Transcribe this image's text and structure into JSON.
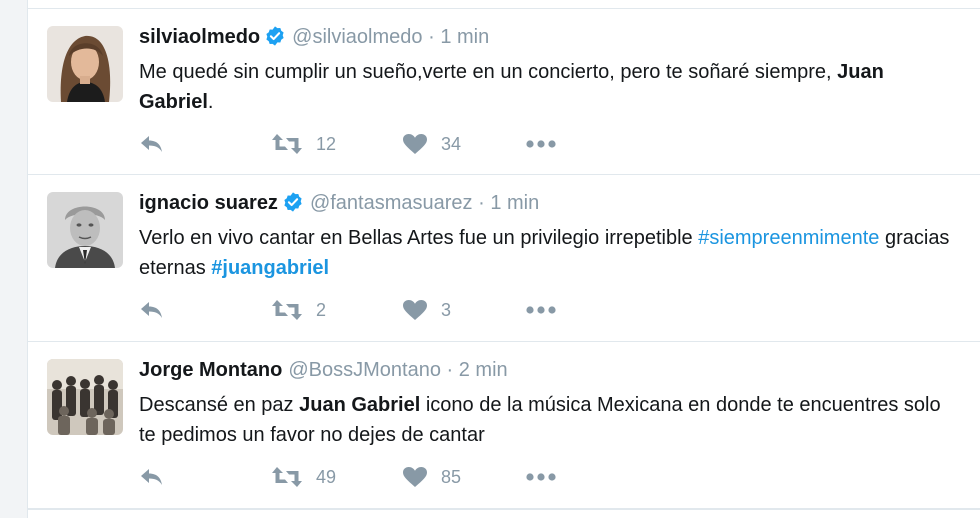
{
  "colors": {
    "background": "#f2f4f6",
    "card": "#ffffff",
    "text": "#14171a",
    "muted": "#8899a6",
    "link": "#1b95e0",
    "verified": "#1da1f2",
    "divider": "#e1e8ed"
  },
  "tweets": [
    {
      "name": "silviaolmedo",
      "verified": true,
      "handle": "@silviaolmedo",
      "separator": "·",
      "time": "1 min",
      "text": [
        {
          "t": "Me quedé sin cumplir un sueño,verte en un concierto, pero te soñaré siempre, "
        },
        {
          "t": "Juan Gabriel",
          "bold": true
        },
        {
          "t": "."
        }
      ],
      "replies": "",
      "retweets": "12",
      "likes": "34",
      "avatar": "portrait-woman"
    },
    {
      "name": "ignacio suarez",
      "verified": true,
      "handle": "@fantasmasuarez",
      "separator": "·",
      "time": "1 min",
      "text": [
        {
          "t": "Verlo en vivo cantar en Bellas Artes fue un privilegio irrepetible "
        },
        {
          "t": "#siempreenmimente",
          "hashtag": true
        },
        {
          "t": " gracias eternas "
        },
        {
          "t": "#juangabriel",
          "hashtag": true,
          "bold": true
        }
      ],
      "replies": "",
      "retweets": "2",
      "likes": "3",
      "avatar": "portrait-man-bw"
    },
    {
      "name": "Jorge Montano",
      "verified": false,
      "handle": "@BossJMontano",
      "separator": "·",
      "time": "2 min",
      "text": [
        {
          "t": "Descansé en paz "
        },
        {
          "t": "Juan Gabriel",
          "bold": true
        },
        {
          "t": " icono de la música Mexicana en donde te encuentres solo te pedimos un favor no dejes de cantar"
        }
      ],
      "replies": "",
      "retweets": "49",
      "likes": "85",
      "avatar": "group-photo"
    }
  ],
  "icons": {
    "reply": "reply-icon",
    "retweet": "retweet-icon",
    "like": "heart-icon",
    "more": "more-icon",
    "verified": "verified-badge-icon"
  }
}
